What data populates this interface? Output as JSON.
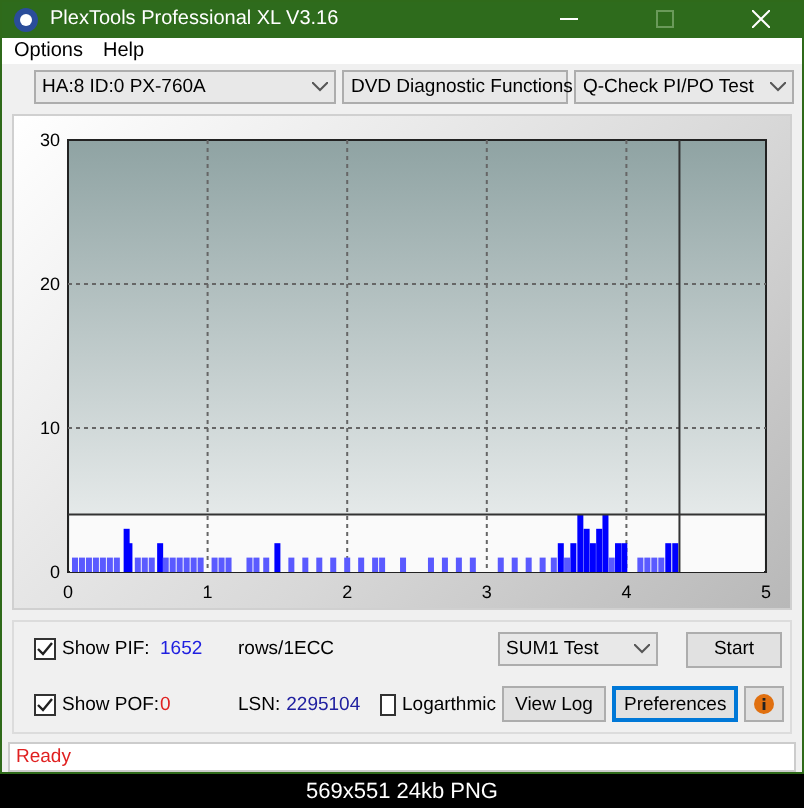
{
  "window": {
    "title": "PlexTools Professional XL V3.16"
  },
  "menu": [
    "Options",
    "Help"
  ],
  "toolbar": {
    "drive": "HA:8 ID:0  PX-760A",
    "function": "DVD Diagnostic Functions",
    "test": "Q-Check PI/PO Test"
  },
  "chart": {
    "chart_data": {
      "type": "bar",
      "xlim": [
        0,
        5
      ],
      "ylim": [
        0,
        30
      ],
      "xticks": [
        0,
        1,
        2,
        3,
        4,
        5
      ],
      "yticks": [
        0,
        10,
        20,
        30
      ],
      "x": [
        0.05,
        0.1,
        0.15,
        0.2,
        0.25,
        0.3,
        0.35,
        0.42,
        0.44,
        0.5,
        0.55,
        0.6,
        0.66,
        0.7,
        0.75,
        0.8,
        0.85,
        0.9,
        0.95,
        1.05,
        1.1,
        1.15,
        1.3,
        1.35,
        1.42,
        1.5,
        1.6,
        1.7,
        1.8,
        1.9,
        2.0,
        2.1,
        2.2,
        2.25,
        2.4,
        2.6,
        2.7,
        2.8,
        2.9,
        3.1,
        3.2,
        3.3,
        3.4,
        3.48,
        3.53,
        3.575,
        3.62,
        3.67,
        3.715,
        3.76,
        3.805,
        3.85,
        3.895,
        3.94,
        3.985,
        4.1,
        4.15,
        4.2,
        4.25,
        4.3,
        4.35
      ],
      "values": [
        1,
        1,
        1,
        1,
        1,
        1,
        1,
        3,
        2,
        1,
        1,
        1,
        2,
        1,
        1,
        1,
        1,
        1,
        1,
        1,
        1,
        1,
        1,
        1,
        1,
        2,
        1,
        1,
        1,
        1,
        1,
        1,
        1,
        1,
        1,
        1,
        1,
        1,
        1,
        1,
        1,
        1,
        1,
        1,
        2,
        1,
        2,
        4,
        3,
        2,
        3,
        4,
        1,
        2,
        2,
        1,
        1,
        1,
        1,
        2,
        2
      ],
      "grid": true,
      "ref_lines": [
        {
          "axis": "y",
          "value": 4
        },
        {
          "axis": "x",
          "value": 4.38
        }
      ],
      "bands": [
        {
          "axis": "y",
          "from": 0,
          "to": 4
        }
      ]
    }
  },
  "controls": {
    "pif": {
      "label": "Show PIF:",
      "checked": true,
      "value": "1652"
    },
    "unit": "rows/1ECC",
    "mode": "SUM1 Test",
    "start": "Start",
    "pof": {
      "label": "Show POF:",
      "checked": true,
      "value": "0"
    },
    "lsn_label": "LSN:",
    "lsn": "2295104",
    "logarithmic": {
      "label": "Logarthmic",
      "checked": false
    },
    "view_log": "View Log",
    "preferences": "Preferences"
  },
  "status_bar": "Ready",
  "caption": "569x551 24kb PNG"
}
